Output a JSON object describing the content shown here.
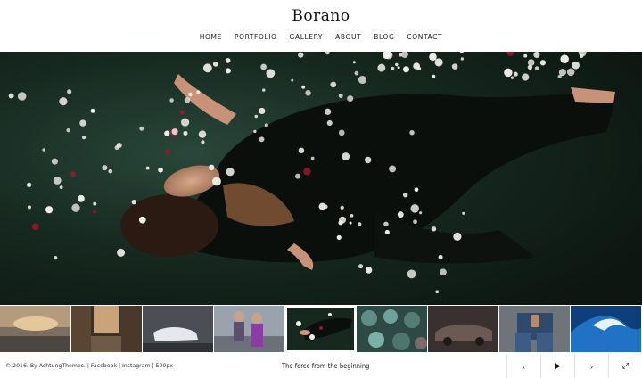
{
  "site": {
    "brand": "Borano"
  },
  "nav": {
    "items": [
      "HOME",
      "PORTFOLIO",
      "GALLERY",
      "ABOUT",
      "BLOG",
      "CONTACT"
    ]
  },
  "footer": {
    "copyright": "© 2016. By AchtungThemes.",
    "links": [
      "Facebook",
      "Instagram",
      "500px"
    ],
    "caption": "The force from the beginning"
  },
  "controls": {
    "prev": "‹",
    "play": "▶",
    "next": "›",
    "fullscreen": "⤢"
  },
  "colors": {
    "water": "#17291f",
    "flower": "#f3f1ea",
    "rose": "#a0142a"
  }
}
